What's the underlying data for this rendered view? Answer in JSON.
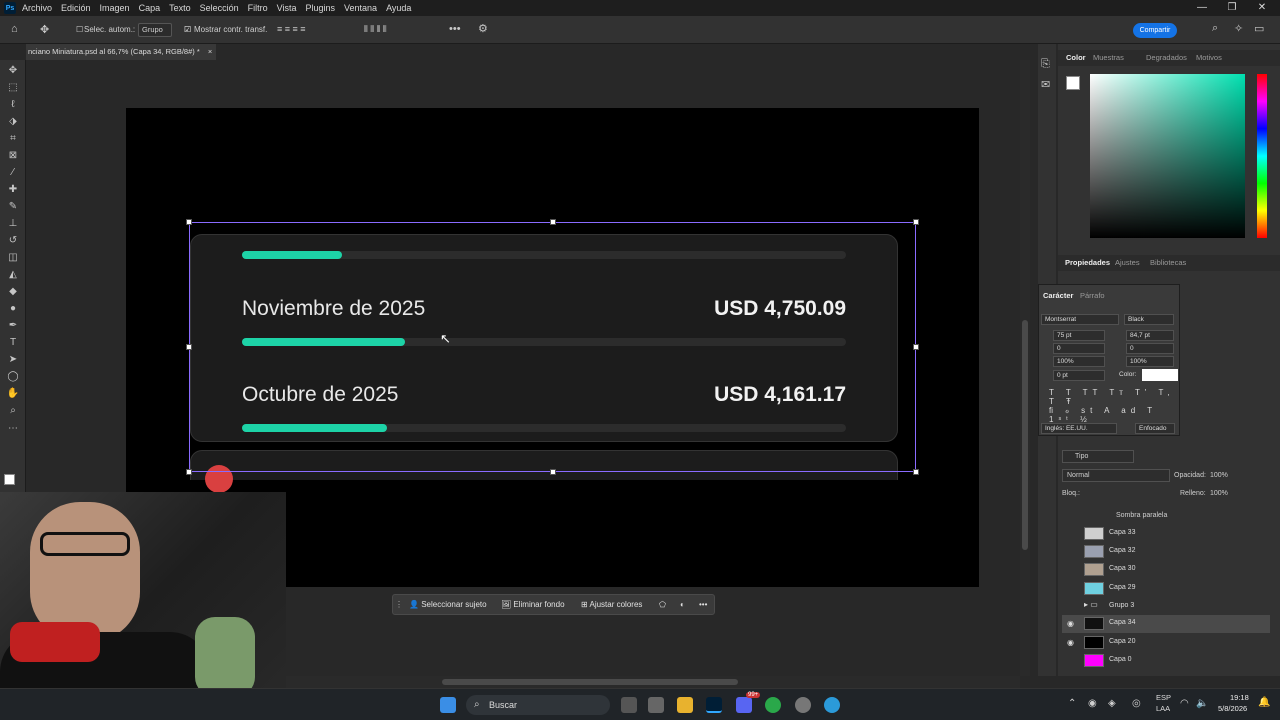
{
  "app": {
    "menu": [
      "Archivo",
      "Edición",
      "Imagen",
      "Capa",
      "Texto",
      "Selección",
      "Filtro",
      "Vista",
      "Plugins",
      "Ventana",
      "Ayuda"
    ],
    "logo": "Ps",
    "window_controls": [
      "—",
      "❐",
      "✕"
    ]
  },
  "options_bar": {
    "auto_select_label": "Selec. autom.:",
    "auto_select_value": "Grupo",
    "show_transform_label": "Mostrar contr. transf.",
    "share_label": "Compartir"
  },
  "document_tab": {
    "title": "nciano Miniatura.psd al 66,7% (Capa 34, RGB/8#) *",
    "close": "×"
  },
  "canvas": {
    "rows": [
      {
        "month": "Noviembre de 2025",
        "amount": "USD 4,750.09",
        "progress": 0.27
      },
      {
        "month": "Octubre de 2025",
        "amount": "USD 4,161.17",
        "progress": 0.24
      }
    ],
    "top_bar_progress": 0.165
  },
  "context_bar": {
    "select_subject": "Seleccionar sujeto",
    "remove_bg": "Eliminar fondo",
    "adjust_colors": "Ajustar colores"
  },
  "color_panel": {
    "tabs": [
      "Color",
      "Muestras",
      "Degradados",
      "Motivos"
    ],
    "hue_color": "#00e0b0"
  },
  "properties_panel": {
    "tabs": [
      "Propiedades",
      "Ajustes",
      "Bibliotecas"
    ]
  },
  "character_panel": {
    "tabs": [
      "Carácter",
      "Párrafo"
    ],
    "font_family": "Montserrat",
    "font_style": "Black",
    "font_size": "75 pt",
    "leading": "84,7 pt",
    "kerning": "0",
    "tracking": "0",
    "vscale": "100%",
    "hscale": "100%",
    "baseline": "0 pt",
    "color_label": "Color:",
    "language": "Inglés: EE.UU.",
    "antialias": "Enfocado"
  },
  "layers_panel": {
    "filter_label": "Tipo",
    "blend_mode": "Normal",
    "opacity_label": "Opacidad:",
    "opacity_value": "100%",
    "lock_label": "Bloq.:",
    "fill_label": "Relleno:",
    "fill_value": "100%",
    "effect_label": "Sombra paralela",
    "layers": [
      {
        "name": "Capa 33",
        "visible": false,
        "selected": false,
        "thumb": "#cfcfcf"
      },
      {
        "name": "Capa 32",
        "visible": false,
        "selected": false,
        "thumb": "#9aa0b0"
      },
      {
        "name": "Capa 30",
        "visible": false,
        "selected": false,
        "thumb": "#b0a090"
      },
      {
        "name": "Capa 29",
        "visible": false,
        "selected": false,
        "thumb": "#6fd0e0"
      },
      {
        "name": "Grupo 3",
        "visible": false,
        "selected": false,
        "thumb": "folder"
      },
      {
        "name": "Capa 34",
        "visible": true,
        "selected": true,
        "thumb": "#111111"
      },
      {
        "name": "Capa 20",
        "visible": true,
        "selected": false,
        "thumb": "#000000"
      },
      {
        "name": "Capa 0",
        "visible": false,
        "selected": false,
        "thumb": "#ff00ff"
      }
    ]
  },
  "taskbar": {
    "search_label": "Buscar",
    "lang_line1": "ESP",
    "lang_line2": "LAA",
    "time": "19:18",
    "date": "5/8/2026",
    "notification_count": "99+"
  }
}
